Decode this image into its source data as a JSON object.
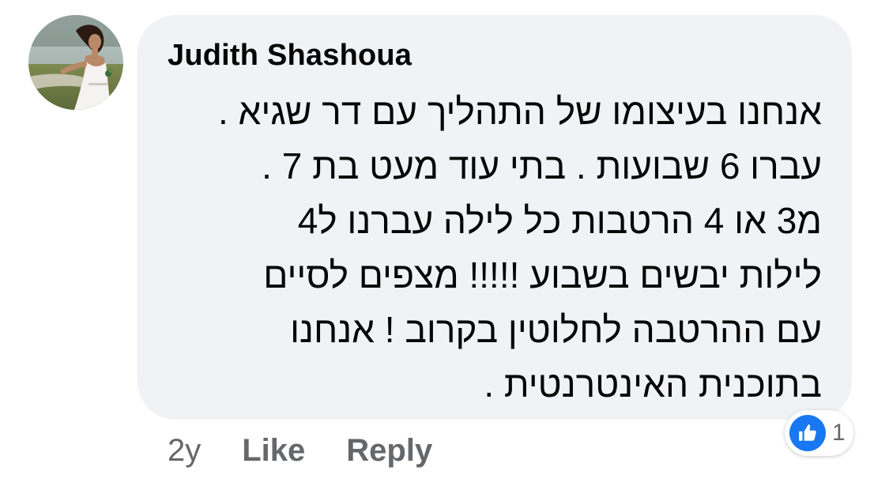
{
  "comment": {
    "author": "Judith Shashoua",
    "text_lines": [
      "אנחנו בעיצומו של התהליך עם דר שגיא .",
      "עברו 6 שבועות . בתי עוד מעט בת 7 .",
      "מ3 או 4 הרטבות כל לילה עברנו ל4",
      "לילות יבשים בשבוע !!!!! מצפים לסיים",
      "עם ההרטבה לחלוטין בקרוב ! אנחנו",
      "בתוכנית האינטרנטית ."
    ]
  },
  "actions": {
    "timestamp": "2y",
    "like_label": "Like",
    "reply_label": "Reply"
  },
  "reaction": {
    "icon": "thumbs-up-icon",
    "count": "1",
    "color": "#1877f2"
  },
  "colors": {
    "bubble_bg": "#f0f2f5",
    "text": "#050505",
    "secondary_text": "#65676b"
  }
}
